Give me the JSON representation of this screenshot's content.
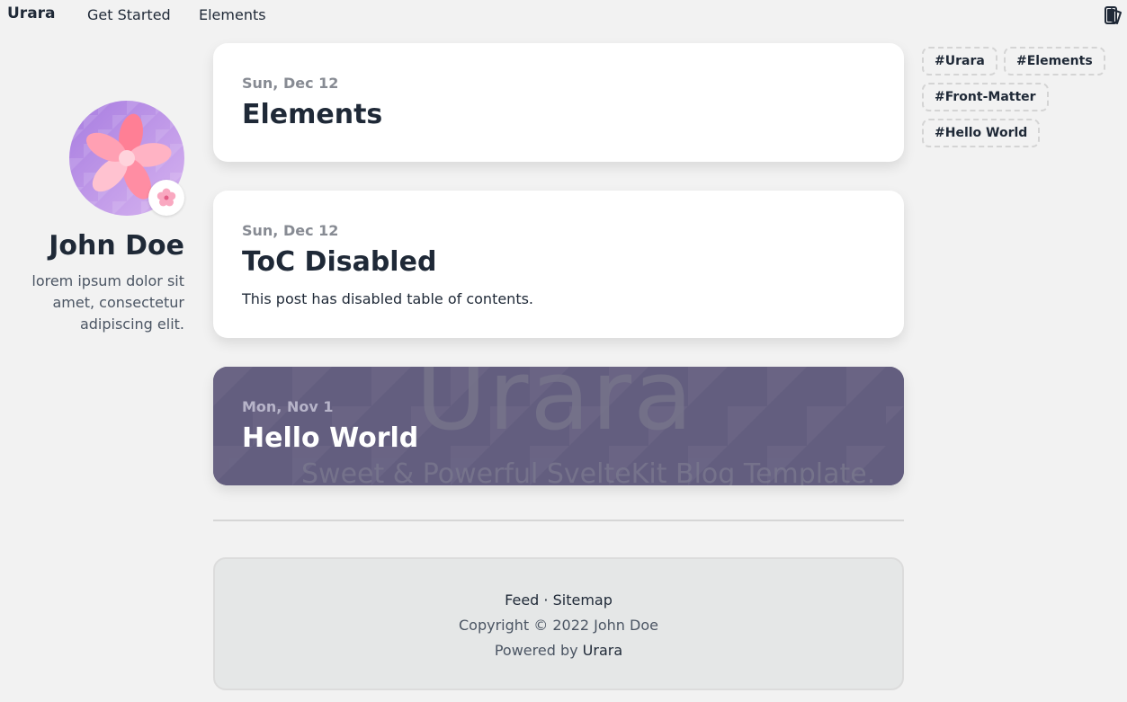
{
  "nav": {
    "brand": "Urara",
    "links": [
      "Get Started",
      "Elements"
    ],
    "theme_icon": "theme-switch-icon"
  },
  "profile": {
    "name": "John Doe",
    "bio": "lorem ipsum dolor sit amet, consectetur adipiscing elit.",
    "avatar_icon": "flower-avatar",
    "badge_icon": "cherry-blossom-icon"
  },
  "posts": [
    {
      "date": "Sun, Dec 12",
      "title": "Elements",
      "summary": ""
    },
    {
      "date": "Sun, Dec 12",
      "title": "ToC Disabled",
      "summary": "This post has disabled table of contents."
    },
    {
      "date": "Mon, Nov 1",
      "title": "Hello World",
      "summary": "",
      "cover_text": "Urara",
      "cover_subtext": "Sweet & Powerful SvelteKit Blog Template."
    }
  ],
  "footer": {
    "feed": "Feed",
    "separator": "·",
    "sitemap": "Sitemap",
    "copyright": "Copyright © 2022 John Doe",
    "powered_prefix": "Powered by",
    "powered_link": "Urara"
  },
  "tags": [
    "#Urara",
    "#Elements",
    "#Front-Matter",
    "#Hello World"
  ],
  "colors": {
    "background": "#f2f2f2",
    "card": "#ffffff",
    "hello_card": "#5b5878",
    "text": "#1f2937",
    "muted": "#878b93"
  }
}
